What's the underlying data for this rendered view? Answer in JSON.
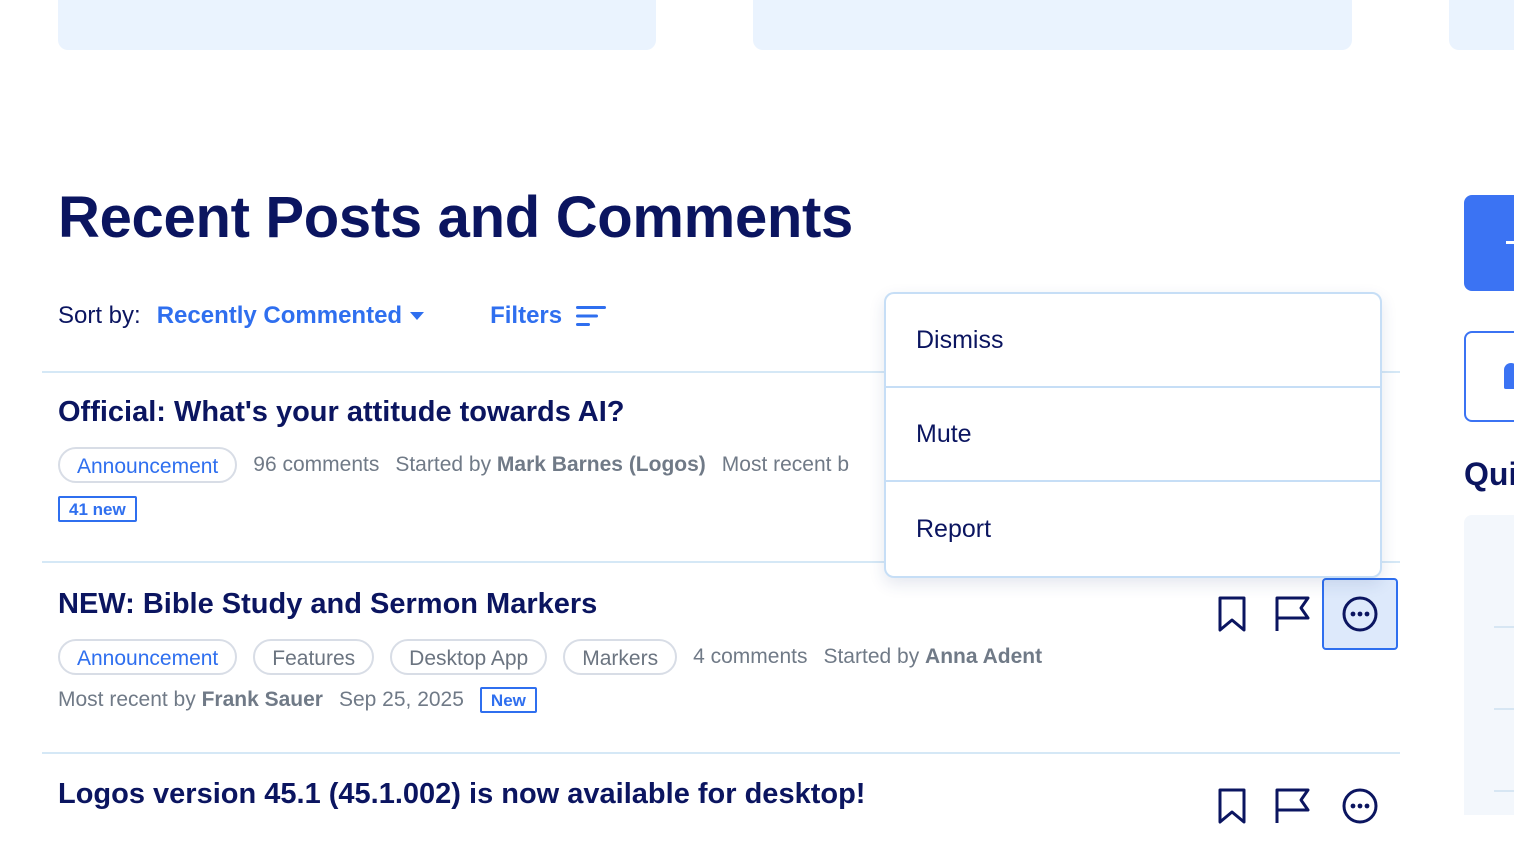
{
  "page": {
    "title": "Recent Posts and Comments"
  },
  "sort": {
    "label": "Sort by:",
    "value": "Recently Commented",
    "filters_label": "Filters"
  },
  "posts": [
    {
      "title": "Official: What's your attitude towards AI?",
      "tags": [
        "Announcement"
      ],
      "comments": "96 comments",
      "started_prefix": "Started by",
      "started_by": "Mark Barnes (Logos)",
      "recent_prefix": "Most recent b",
      "badge": "41 new"
    },
    {
      "title": "NEW: Bible Study and Sermon Markers",
      "tags": [
        "Announcement",
        "Features",
        "Desktop App",
        "Markers"
      ],
      "comments": "4 comments",
      "started_prefix": "Started by",
      "started_by": "Anna Adent",
      "recent_prefix": "Most recent by",
      "recent_by": "Frank Sauer",
      "date": "Sep 25, 2025",
      "badge": "New"
    },
    {
      "title": "Logos version 45.1 (45.1.002) is now available for desktop!"
    }
  ],
  "menu": {
    "items": [
      "Dismiss",
      "Mute",
      "Report"
    ]
  },
  "sidebar": {
    "heading_partial": "Qui"
  },
  "colors": {
    "navy": "#0b1560",
    "accent": "#2f6fef",
    "muted": "#707a87",
    "divider": "#d5e8f6",
    "card": "#eaf3fe"
  },
  "icons": {
    "bookmark": "bookmark-icon",
    "flag": "flag-icon",
    "more": "more-horizontal-icon",
    "filter": "filter-lines-icon",
    "caret": "caret-down-icon"
  }
}
